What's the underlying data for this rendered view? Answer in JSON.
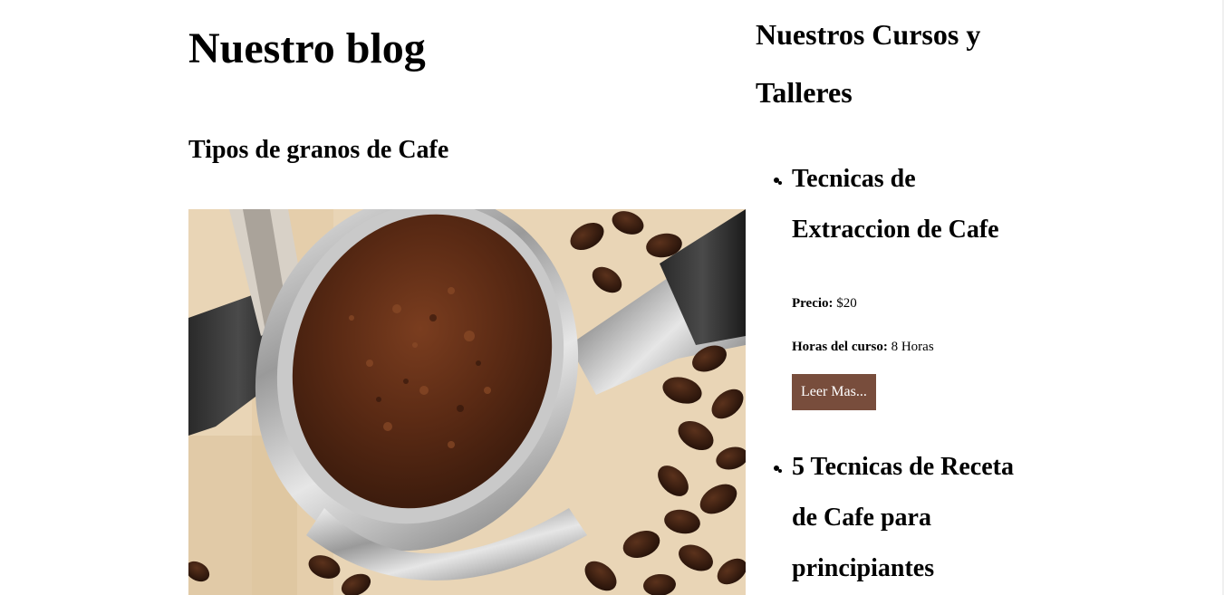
{
  "blog": {
    "title": "Nuestro blog",
    "post_title": "Tipos de granos de Cafe",
    "image_alt": "Portafiltro con cafe molido y granos de cafe"
  },
  "sidebar": {
    "title": "Nuestros Cursos y Talleres",
    "courses": [
      {
        "title": "Tecnicas de Extraccion de Cafe",
        "price_label": "Precio:",
        "price_value": "$20",
        "hours_label": "Horas del curso:",
        "hours_value": "8 Horas",
        "button_label": "Leer Mas..."
      },
      {
        "title": "5 Tecnicas de Receta de Cafe para principiantes"
      }
    ]
  },
  "colors": {
    "button_bg": "#784d3c",
    "button_text": "#ffffff",
    "page_bg": "#ffffff",
    "text": "#000000"
  }
}
